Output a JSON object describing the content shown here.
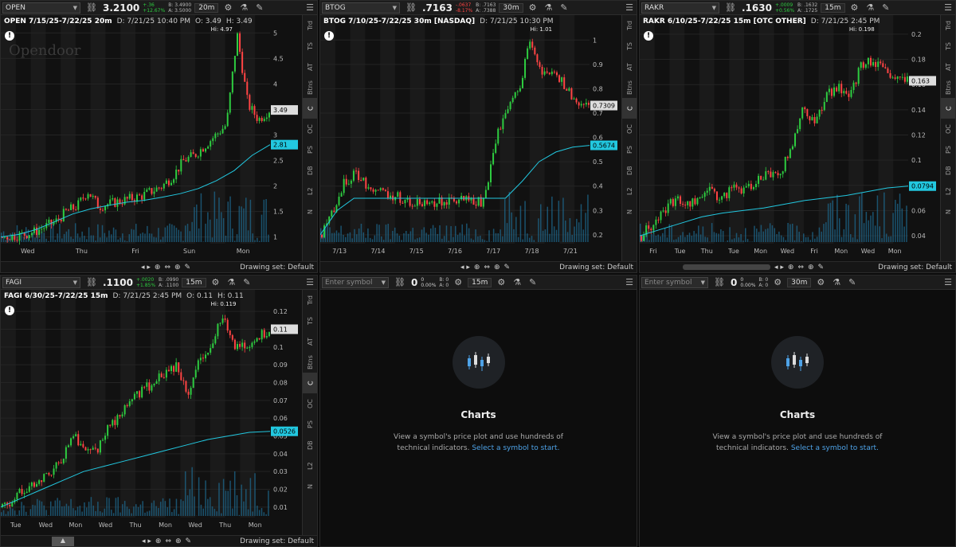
{
  "colors": {
    "bg": "#111111",
    "up": "#2ecc40",
    "down": "#ff4444",
    "vwap": "#22c8e0",
    "volume": "#1e6e96"
  },
  "icons": {
    "link": "link-icon",
    "settings": "gear-icon",
    "flask": "flask-icon",
    "menu": "menu-icon",
    "zoom": "magnifier-icon",
    "drawing": "pencil-icon",
    "alert": "alert-icon"
  },
  "rail_labels": [
    "Trd",
    "TS",
    "AT",
    "Btns",
    "C",
    "OC",
    "PS",
    "DB",
    "L2",
    "N"
  ],
  "footer": {
    "drawing_set": "Drawing set: Default"
  },
  "panels": [
    {
      "symbol": "OPEN",
      "price": "3.2100",
      "chg": "+.36",
      "chgpct": "+12.67%",
      "bid": "B: 3.4900",
      "ask": "A: 3.5000",
      "tf": "20m",
      "header": {
        "title": "OPEN 7/15/25-7/22/25 20m",
        "date": "D: 7/21/25 10:40 PM",
        "open": "O: 3.49",
        "high": "H: 3.49"
      },
      "watermark": "Opendoor",
      "hi_label": "Hi: 4.97",
      "price_axis": [
        "5",
        "4.5",
        "4",
        "3.5",
        "3",
        "2.5",
        "2",
        "1.5",
        "1"
      ],
      "last_tag": "3.49",
      "vwap_tag": "2.81",
      "x_labels": [
        "Wed",
        "Thu",
        "Fri",
        "Sun",
        "Mon"
      ],
      "chart_data": {
        "type": "candlestick",
        "ylim": [
          0.9,
          5.1
        ],
        "close": [
          1.0,
          1.02,
          1.05,
          1.1,
          1.2,
          1.3,
          1.5,
          1.6,
          1.9,
          1.6,
          1.65,
          1.7,
          1.75,
          1.8,
          1.9,
          2.0,
          2.2,
          2.5,
          2.6,
          2.8,
          3.0,
          3.2,
          4.97,
          3.6,
          3.3,
          3.49
        ],
        "vwap": [
          1.0,
          1.05,
          1.15,
          1.3,
          1.45,
          1.55,
          1.62,
          1.68,
          1.72,
          1.78,
          1.85,
          1.95,
          2.1,
          2.3,
          2.6,
          2.81
        ]
      }
    },
    {
      "symbol": "BTOG",
      "price": ".7163",
      "chg": "-.0637",
      "chgpct": "-8.17%",
      "bid": "B: .7163",
      "ask": "A: .7388",
      "tf": "30m",
      "header": {
        "title": "BTOG 7/10/25-7/22/25 30m [NASDAQ]",
        "date": "D: 7/21/25 10:30 PM"
      },
      "hi_label": "Hi: 1.01",
      "price_axis": [
        "1",
        "0.9",
        "0.8",
        "0.7",
        "0.6",
        "0.5",
        "0.4",
        "0.3",
        "0.2"
      ],
      "last_tag": "0.7309",
      "vwap_tag": "0.5674",
      "x_labels": [
        "7/13",
        "7/14",
        "7/15",
        "7/16",
        "7/17",
        "7/18",
        "7/21"
      ],
      "chart_data": {
        "type": "candlestick",
        "ylim": [
          0.17,
          1.05
        ],
        "close": [
          0.2,
          0.3,
          0.42,
          0.45,
          0.4,
          0.38,
          0.36,
          0.35,
          0.33,
          0.34,
          0.33,
          0.34,
          0.35,
          0.33,
          0.34,
          0.6,
          0.7,
          0.8,
          1.01,
          0.85,
          0.88,
          0.8,
          0.75,
          0.73
        ],
        "vwap": [
          0.2,
          0.3,
          0.35,
          0.35,
          0.35,
          0.35,
          0.35,
          0.35,
          0.35,
          0.35,
          0.35,
          0.35,
          0.42,
          0.5,
          0.54,
          0.56,
          0.567
        ]
      }
    },
    {
      "symbol": "RAKR",
      "price": ".1630",
      "chg": "+.0009",
      "chgpct": "+0.56%",
      "bid": "B: .1632",
      "ask": "A: .1725",
      "tf": "15m",
      "header": {
        "title": "RAKR 6/10/25-7/22/25 15m [OTC OTHER]",
        "date": "D: 7/21/25 2:45 PM"
      },
      "hi_label": "Hi: 0.198",
      "price_axis": [
        "0.2",
        "0.18",
        "0.16",
        "0.14",
        "0.12",
        "0.1",
        "0.08",
        "0.06",
        "0.04"
      ],
      "last_tag": "0.163",
      "vwap_tag": "0.0794",
      "x_labels": [
        "Fri",
        "Tue",
        "Thu",
        "Tue",
        "Mon",
        "Wed",
        "Fri",
        "Mon",
        "Wed",
        "Mon"
      ],
      "chart_data": {
        "type": "candlestick",
        "ylim": [
          0.035,
          0.205
        ],
        "close": [
          0.04,
          0.05,
          0.06,
          0.07,
          0.065,
          0.07,
          0.075,
          0.07,
          0.08,
          0.075,
          0.085,
          0.09,
          0.09,
          0.11,
          0.14,
          0.13,
          0.15,
          0.16,
          0.15,
          0.175,
          0.18,
          0.17,
          0.165,
          0.163
        ],
        "vwap": [
          0.04,
          0.045,
          0.05,
          0.055,
          0.058,
          0.06,
          0.062,
          0.065,
          0.068,
          0.07,
          0.072,
          0.075,
          0.078,
          0.0794
        ]
      }
    },
    {
      "symbol": "FAGI",
      "price": ".1100",
      "chg": "+.0020",
      "chgpct": "+1.85%",
      "bid": "B: .0990",
      "ask": "A: .1100",
      "tf": "15m",
      "header": {
        "title": "FAGI 6/30/25-7/22/25 15m",
        "date": "D: 7/21/25 2:45 PM",
        "open": "O: 0.11",
        "high": "H: 0.11"
      },
      "hi_label": "Hi: 0.119",
      "price_axis": [
        "0.12",
        "0.11",
        "0.1",
        "0.09",
        "0.08",
        "0.07",
        "0.06",
        "0.05",
        "0.04",
        "0.03",
        "0.02",
        "0.01"
      ],
      "last_tag": "0.11",
      "vwap_tag": "0.0526",
      "x_labels": [
        "Tue",
        "Wed",
        "Mon",
        "Wed",
        "Thu",
        "Mon",
        "Wed",
        "Thu",
        "Mon"
      ],
      "chart_data": {
        "type": "candlestick",
        "ylim": [
          0.005,
          0.125
        ],
        "close": [
          0.01,
          0.015,
          0.02,
          0.025,
          0.03,
          0.035,
          0.05,
          0.045,
          0.04,
          0.055,
          0.06,
          0.07,
          0.075,
          0.08,
          0.085,
          0.09,
          0.075,
          0.095,
          0.1,
          0.119,
          0.1,
          0.1,
          0.105,
          0.11
        ],
        "vwap": [
          0.01,
          0.015,
          0.02,
          0.025,
          0.03,
          0.033,
          0.036,
          0.039,
          0.042,
          0.045,
          0.048,
          0.05,
          0.052,
          0.0526
        ]
      }
    }
  ],
  "empty": {
    "placeholder": "Enter symbol",
    "zero": "0",
    "pct": "0.00%",
    "bid": "B: 0",
    "ask": "A: 0",
    "tf1": "15m",
    "tf2": "30m",
    "title": "Charts",
    "text": "View a symbol's price plot and use hundreds of technical indicators.",
    "link": "Select a symbol to start."
  }
}
